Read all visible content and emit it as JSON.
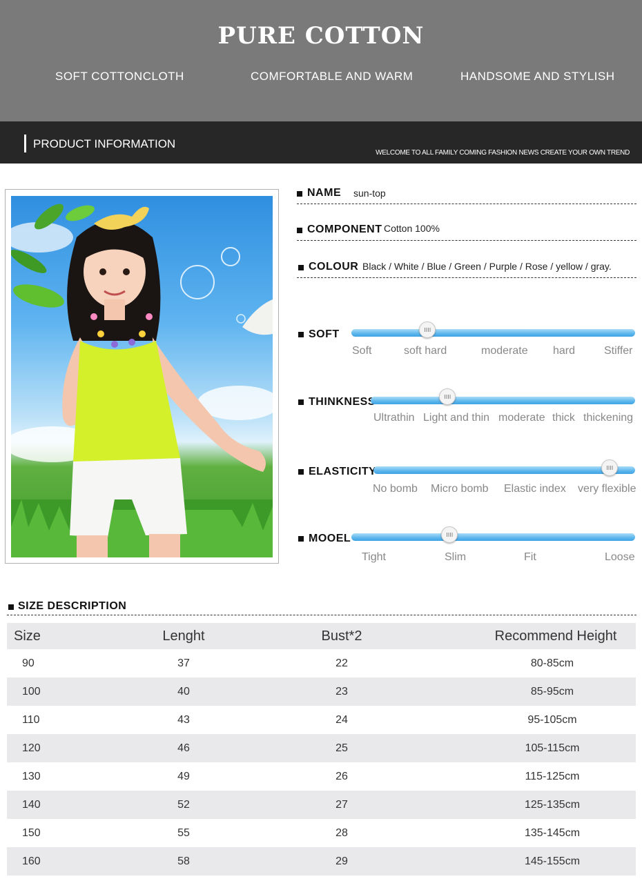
{
  "hero": {
    "title": "PURE COTTON",
    "features": [
      "SOFT COTTONCLOTH",
      "COMFORTABLE AND WARM",
      "HANDSOME AND STYLISH"
    ]
  },
  "bar": {
    "title": "PRODUCT INFORMATION",
    "slogan": "WELCOME TO ALL FAMILY  COMING FASHION NEWS  CREATE YOUR OWN TREND"
  },
  "info": {
    "name_label": "NAME",
    "name_value": "sun-top",
    "component_label": "COMPONENT",
    "component_value": "Cotton 100%",
    "colour_label": "COLOUR",
    "colour_value": "Black / White / Blue / Green / Purple / Rose / yellow / gray."
  },
  "sliders": {
    "soft": {
      "label": "SOFT",
      "options": [
        "Soft",
        "soft hard",
        "moderate",
        "hard",
        "Stiffer"
      ],
      "selected": "soft hard"
    },
    "thickness": {
      "label": "THINKNESS",
      "options": [
        "Ultrathin",
        "Light and thin",
        "moderate",
        "thick",
        "thickening"
      ],
      "selected": "Light and thin"
    },
    "elasticity": {
      "label": "ELASTICITY",
      "options": [
        "No bomb",
        "Micro bomb",
        "Elastic index",
        "very flexible"
      ],
      "selected": "very flexible"
    },
    "model": {
      "label": "MOOEL",
      "options": [
        "Tight",
        "Slim",
        "Fit",
        "Loose"
      ],
      "selected": "Slim"
    }
  },
  "size": {
    "title": "SIZE DESCRIPTION",
    "columns": [
      "Size",
      "Lenght",
      "Bust*2",
      "Recommend Height"
    ],
    "rows": [
      [
        "90",
        "37",
        "22",
        "80-85cm"
      ],
      [
        "100",
        "40",
        "23",
        "85-95cm"
      ],
      [
        "110",
        "43",
        "24",
        "95-105cm"
      ],
      [
        "120",
        "46",
        "25",
        "105-115cm"
      ],
      [
        "130",
        "49",
        "26",
        "115-125cm"
      ],
      [
        "140",
        "52",
        "27",
        "125-135cm"
      ],
      [
        "150",
        "55",
        "28",
        "135-145cm"
      ],
      [
        "160",
        "58",
        "29",
        "145-155cm"
      ]
    ]
  },
  "colors": {
    "hero_bg": "#7a7a7a",
    "bar_bg": "#272727",
    "slider": "#5cb6ec",
    "row_shade": "#e9e9eb"
  },
  "icons": {
    "bullet": "square-bullet-icon",
    "knob": "slider-knob-icon"
  }
}
